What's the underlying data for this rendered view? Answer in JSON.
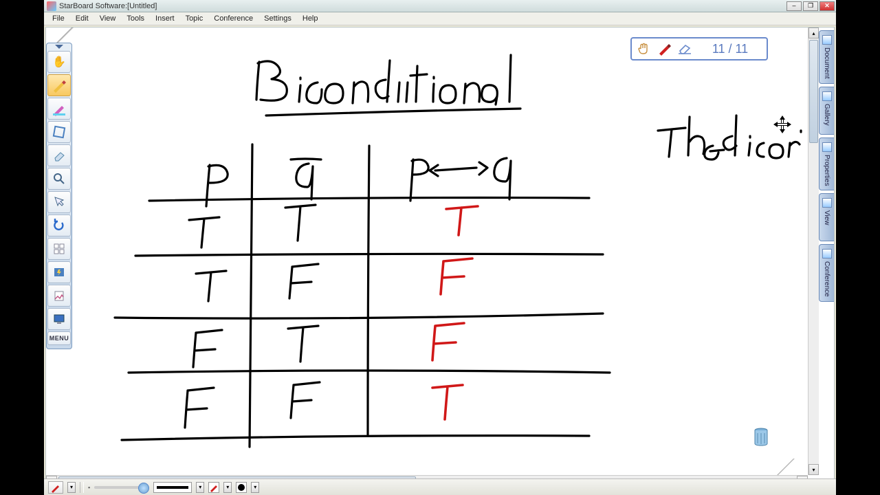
{
  "window": {
    "title": "StarBoard Software:[Untitled]"
  },
  "menubar": [
    "File",
    "Edit",
    "View",
    "Tools",
    "Insert",
    "Topic",
    "Conference",
    "Settings",
    "Help"
  ],
  "palette": {
    "tools": [
      {
        "name": "select-tool",
        "icon": "✋"
      },
      {
        "name": "pen-tool",
        "icon": "✎",
        "selected": true
      },
      {
        "name": "highlighter-tool",
        "icon": "✎"
      },
      {
        "name": "shape-tool",
        "icon": "◇"
      },
      {
        "name": "eraser-tool",
        "icon": "⌫"
      },
      {
        "name": "zoom-tool",
        "icon": "🔍"
      },
      {
        "name": "pointer-tool",
        "icon": "↖"
      },
      {
        "name": "undo-tool",
        "icon": "↶"
      },
      {
        "name": "new-page-tool",
        "icon": "▦"
      },
      {
        "name": "flash-tool",
        "icon": "⚡"
      },
      {
        "name": "clipboard-tool",
        "icon": "📋"
      },
      {
        "name": "screen-tool",
        "icon": "🖵"
      }
    ],
    "menu_label": "MENU"
  },
  "side_tabs": [
    {
      "name": "document-tab",
      "label": "Document"
    },
    {
      "name": "gallery-tab",
      "label": "Gallery"
    },
    {
      "name": "properties-tab",
      "label": "Properties"
    },
    {
      "name": "view-tab",
      "label": "View"
    },
    {
      "name": "conference-tab",
      "label": "Conference"
    }
  ],
  "float_toolbar": {
    "page_counter": "11 / 11"
  },
  "propbar": {
    "slider_hint": "thickness",
    "line_width_label": "",
    "color_label": ""
  },
  "handwriting": {
    "title": "Biconditional",
    "side_note": "The bicon",
    "table": {
      "headers": [
        "P",
        "q",
        "p↔q"
      ],
      "rows": [
        {
          "p": "T",
          "q": "T",
          "pq": "T"
        },
        {
          "p": "T",
          "q": "F",
          "pq": "F"
        },
        {
          "p": "F",
          "q": "T",
          "pq": "F"
        },
        {
          "p": "F",
          "q": "F",
          "pq": "T"
        }
      ],
      "result_color": "#d01818"
    }
  },
  "icons": {
    "minimize": "–",
    "maximize": "❐",
    "close": "✕",
    "hand": "✋",
    "pen": "✎",
    "eraser": "◺",
    "up": "▴",
    "down": "▾",
    "left": "◂",
    "right": "▸"
  }
}
